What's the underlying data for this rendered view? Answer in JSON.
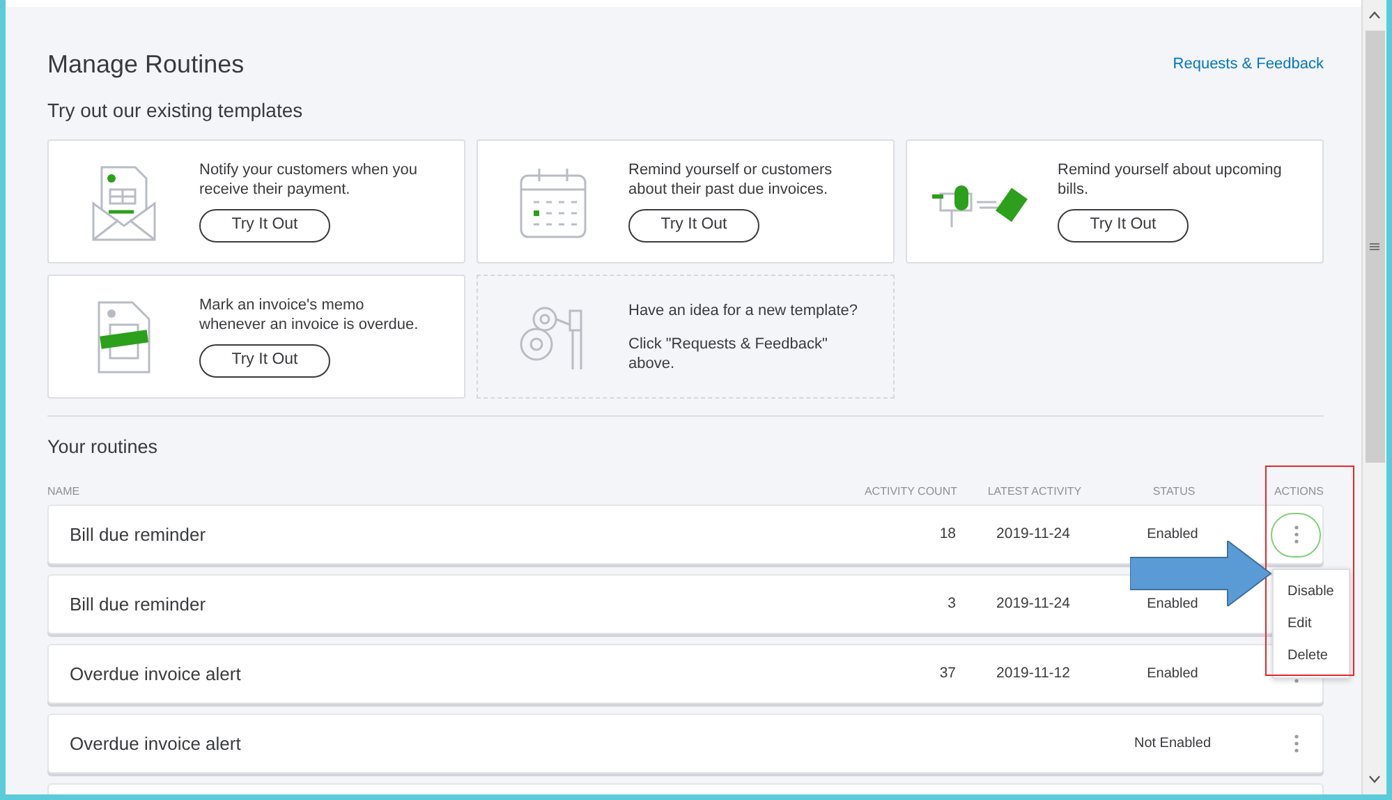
{
  "title": "Manage Routines",
  "feedback_link": "Requests & Feedback",
  "templates_heading": "Try out our existing templates",
  "templates": [
    {
      "kind": "template",
      "text": "Notify your customers when you receive their payment.",
      "button": "Try It Out"
    },
    {
      "kind": "template",
      "text": "Remind yourself or customers about their past due invoices.",
      "button": "Try It Out"
    },
    {
      "kind": "template",
      "text": "Remind yourself about upcoming bills.",
      "button": "Try It Out"
    },
    {
      "kind": "template",
      "text": "Mark an invoice's memo whenever an invoice is overdue.",
      "button": "Try It Out"
    },
    {
      "kind": "idea",
      "text": "Have an idea for a new template?",
      "note": "Click \"Requests & Feedback\" above."
    }
  ],
  "routines_heading": "Your routines",
  "columns": [
    "NAME",
    "ACTIVITY COUNT",
    "LATEST ACTIVITY",
    "STATUS",
    "ACTIONS"
  ],
  "rows": [
    {
      "name": "Bill due reminder",
      "activity_count": "18",
      "latest_activity": "2019-11-24",
      "status": "Enabled",
      "focused": true
    },
    {
      "name": "Bill due reminder",
      "activity_count": "3",
      "latest_activity": "2019-11-24",
      "status": "Enabled",
      "focused": false
    },
    {
      "name": "Overdue invoice alert",
      "activity_count": "37",
      "latest_activity": "2019-11-12",
      "status": "Enabled",
      "focused": false
    },
    {
      "name": "Overdue invoice alert",
      "status": "Not Enabled",
      "focused": false
    }
  ],
  "action_menu": [
    "Disable",
    "Edit",
    "Delete"
  ]
}
